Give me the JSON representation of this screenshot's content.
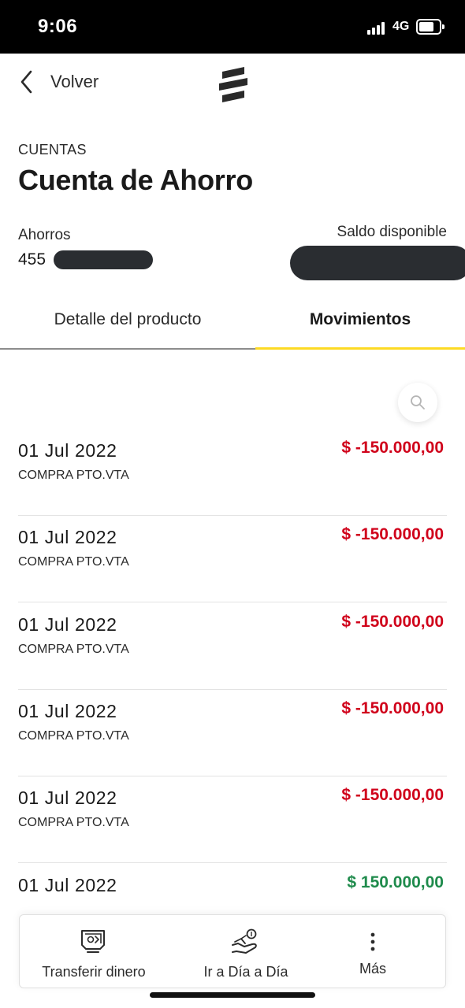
{
  "status_bar": {
    "time": "9:06",
    "network": "4G"
  },
  "header": {
    "back_label": "Volver"
  },
  "section_label": "CUENTAS",
  "page_title": "Cuenta de Ahorro",
  "account": {
    "type_label": "Ahorros",
    "number_visible": "455",
    "balance_label": "Saldo disponible"
  },
  "tabs": [
    {
      "label": "Detalle del producto",
      "active": false
    },
    {
      "label": "Movimientos",
      "active": true
    }
  ],
  "transactions": [
    {
      "date": "01 Jul 2022",
      "description": "COMPRA PTO.VTA",
      "amount": "$ -150.000,00",
      "kind": "debit"
    },
    {
      "date": "01 Jul 2022",
      "description": "COMPRA PTO.VTA",
      "amount": "$ -150.000,00",
      "kind": "debit"
    },
    {
      "date": "01 Jul 2022",
      "description": "COMPRA PTO.VTA",
      "amount": "$ -150.000,00",
      "kind": "debit"
    },
    {
      "date": "01 Jul 2022",
      "description": "COMPRA PTO.VTA",
      "amount": "$ -150.000,00",
      "kind": "debit"
    },
    {
      "date": "01 Jul 2022",
      "description": "COMPRA PTO.VTA",
      "amount": "$ -150.000,00",
      "kind": "debit"
    },
    {
      "date": "01 Jul 2022",
      "description": "",
      "amount": "$ 150.000,00",
      "kind": "credit"
    }
  ],
  "bottom_nav": [
    {
      "label": "Transferir dinero",
      "icon": "transfer-money-icon"
    },
    {
      "label": "Ir a Día a Día",
      "icon": "hand-money-icon"
    },
    {
      "label": "Más",
      "icon": "more-vertical-icon"
    }
  ],
  "colors": {
    "accent": "#fdda24",
    "debit": "#d0021b",
    "credit": "#1f8b4c"
  }
}
